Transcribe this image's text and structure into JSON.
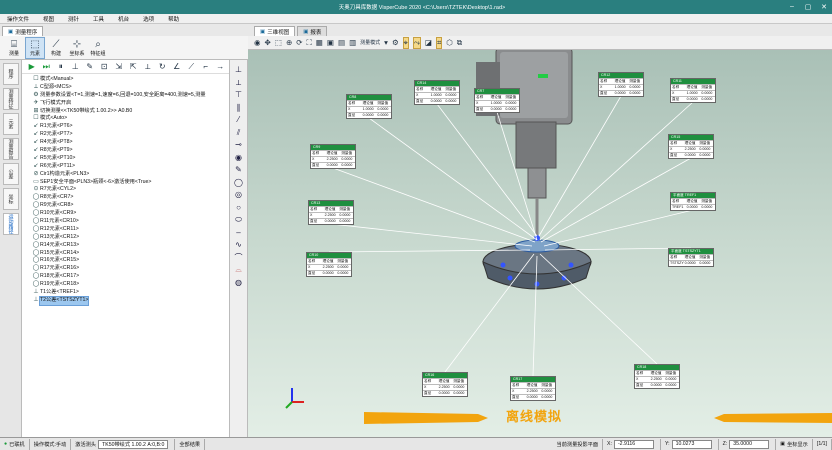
{
  "window": {
    "title": "天奥刀具库数据 VisperCube 2020   <C:\\Users\\TZTEK\\Desktop\\1.rad>"
  },
  "menu": [
    "操作文件",
    "视图",
    "测针",
    "工具",
    "机台",
    "选项",
    "帮助"
  ],
  "left_tabs": [
    "测量程序"
  ],
  "ribbon": [
    {
      "label": "测量",
      "icon": "ruler-icon"
    },
    {
      "label": "元素",
      "icon": "element-icon"
    },
    {
      "label": "构建",
      "icon": "construct-icon"
    },
    {
      "label": "坐标系",
      "icon": "coordinate-icon"
    },
    {
      "label": "特征组",
      "icon": "feature-search-icon"
    }
  ],
  "side_tabs": [
    "程序",
    "测量特征",
    "元素",
    "测量报告",
    "公差",
    "坐标",
    "运动路径"
  ],
  "tree": [
    {
      "label": "模式<Manual>",
      "icon": "☐"
    },
    {
      "label": "C型源<MCS>",
      "icon": "⟂"
    },
    {
      "label": "测量参数设置<T=1,测速=1,速度=6,回退=100,安全距离=400,测速=5,测量",
      "icon": "⚙"
    },
    {
      "label": "飞行模式开启",
      "icon": "✈"
    },
    {
      "label": "切换测量<<TK50带绘式 1.00.2>>  A0.B0",
      "icon": "⊞"
    },
    {
      "label": "模式<Auto>",
      "icon": "☐"
    },
    {
      "label": "R1元素<PT6>",
      "icon": "↙"
    },
    {
      "label": "R2元素<PT7>",
      "icon": "↙"
    },
    {
      "label": "R4元素<PT8>",
      "icon": "↙"
    },
    {
      "label": "R8元素<PT9>",
      "icon": "↙"
    },
    {
      "label": "R5元素<PT10>",
      "icon": "↙"
    },
    {
      "label": "R6元素<PT11>",
      "icon": "↙"
    },
    {
      "label": "Cir1构造元素<PLN3>",
      "icon": "⊘"
    },
    {
      "label": "SEP1安全平面<PLN3>瓶颈<-6>激活使用<True>",
      "icon": "▭"
    },
    {
      "label": "R7元素<CYL2>",
      "icon": "⊙"
    },
    {
      "label": "R8元素<CR7>",
      "icon": "◯"
    },
    {
      "label": "R9元素<CR8>",
      "icon": "◯"
    },
    {
      "label": "R10元素<CR9>",
      "icon": "◯"
    },
    {
      "label": "R11元素<CR10>",
      "icon": "◯"
    },
    {
      "label": "R12元素<CR11>",
      "icon": "◯"
    },
    {
      "label": "R13元素<CR12>",
      "icon": "◯"
    },
    {
      "label": "R14元素<CR13>",
      "icon": "◯"
    },
    {
      "label": "R15元素<CR14>",
      "icon": "◯"
    },
    {
      "label": "R16元素<CR15>",
      "icon": "◯"
    },
    {
      "label": "R17元素<CR16>",
      "icon": "◯"
    },
    {
      "label": "R18元素<CR17>",
      "icon": "◯"
    },
    {
      "label": "R19元素<CR18>",
      "icon": "◯"
    },
    {
      "label": "T1公差<TREF1>",
      "icon": "⊥"
    },
    {
      "label": "T2公差<TSTSZYT1>",
      "icon": "⊥",
      "selected": true
    }
  ],
  "view_tabs": [
    "三维视图",
    "报表"
  ],
  "view_toolbar": {
    "mode_label": "测量模式"
  },
  "overlay_label": "离线模拟",
  "cards": [
    {
      "title": "CR8",
      "rows": [
        [
          "名称",
          "理论值",
          "测量值"
        ],
        [
          "X",
          "1.0000",
          "0.0000"
        ],
        [
          "直径",
          "0.0000",
          "0.0000"
        ]
      ]
    },
    {
      "title": "CR14",
      "rows": [
        [
          "名称",
          "理论值",
          "测量值"
        ],
        [
          "X",
          "1.0000",
          "0.0000"
        ],
        [
          "直径",
          "0.0000",
          "0.0000"
        ]
      ]
    },
    {
      "title": "CR7",
      "rows": [
        [
          "名称",
          "理论值",
          "测量值"
        ],
        [
          "X",
          "1.0000",
          "0.0000"
        ],
        [
          "直径",
          "0.0000",
          "0.0000"
        ]
      ]
    },
    {
      "title": "CR12",
      "rows": [
        [
          "名称",
          "理论值",
          "测量值"
        ],
        [
          "X",
          "1.0000",
          "0.0000"
        ],
        [
          "直径",
          "0.0000",
          "0.0000"
        ]
      ]
    },
    {
      "title": "CR11",
      "rows": [
        [
          "名称",
          "理论值",
          "测量值"
        ],
        [
          "X",
          "1.0000",
          "0.0000"
        ],
        [
          "直径",
          "0.0000",
          "0.0000"
        ]
      ]
    },
    {
      "title": "CR9",
      "rows": [
        [
          "名称",
          "理论值",
          "测量值"
        ],
        [
          "X",
          "2.2500",
          "0.0000"
        ],
        [
          "直径",
          "0.0000",
          "0.0000"
        ]
      ]
    },
    {
      "title": "CR15",
      "rows": [
        [
          "名称",
          "理论值",
          "测量值"
        ],
        [
          "X",
          "2.2500",
          "0.0000"
        ],
        [
          "直径",
          "0.0000",
          "0.0000"
        ]
      ]
    },
    {
      "title": "CR13",
      "rows": [
        [
          "名称",
          "理论值",
          "测量值"
        ],
        [
          "X",
          "2.2500",
          "0.0000"
        ],
        [
          "直径",
          "0.0000",
          "0.0000"
        ]
      ]
    },
    {
      "title": "平面度 TREF1",
      "rows": [
        [
          "名称",
          "理论值",
          "测量值"
        ],
        [
          "TREF1",
          "0.0000",
          "0.0000"
        ]
      ]
    },
    {
      "title": "CR10",
      "rows": [
        [
          "名称",
          "理论值",
          "测量值"
        ],
        [
          "X",
          "2.2500",
          "0.0000"
        ],
        [
          "直径",
          "0.0000",
          "0.0000"
        ]
      ]
    },
    {
      "title": "平面度 TSTSZYT1",
      "rows": [
        [
          "名称",
          "理论值",
          "测量值"
        ],
        [
          "TSTSZYT1",
          "0.0000",
          "0.0000"
        ]
      ]
    },
    {
      "title": "CR16",
      "rows": [
        [
          "名称",
          "理论值",
          "测量值"
        ],
        [
          "X",
          "2.2500",
          "0.0000"
        ],
        [
          "直径",
          "0.0000",
          "0.0000"
        ]
      ]
    },
    {
      "title": "CR17",
      "rows": [
        [
          "名称",
          "理论值",
          "测量值"
        ],
        [
          "X",
          "2.2500",
          "0.0000"
        ],
        [
          "直径",
          "0.0000",
          "0.0000"
        ]
      ]
    },
    {
      "title": "CR18",
      "rows": [
        [
          "名称",
          "理论值",
          "测量值"
        ],
        [
          "X",
          "2.2500",
          "0.0000"
        ],
        [
          "直径",
          "0.0000",
          "0.0000"
        ]
      ]
    }
  ],
  "status": {
    "connection": "已联机",
    "mode_label": "操作模式:手动",
    "probe_label": "激活测头",
    "probe_value": "TK50带绘式 1.00.2  A:0,B:0",
    "all_label": "全部结果",
    "plane_label": "当前测量投影平面",
    "x_label": "X:",
    "x_value": "-2.9116",
    "y_label": "Y:",
    "y_value": "10.0273",
    "z_label": "Z:",
    "z_value": "35.0000",
    "display_label": "坐标显示",
    "pages": "1/1"
  },
  "colors": {
    "title_bar": "#2a7f7f",
    "card_header": "#1f8f3f",
    "leader_line": "#ffffff",
    "arrow": "#f2a40e",
    "overlay_text": "#f2a40e"
  }
}
